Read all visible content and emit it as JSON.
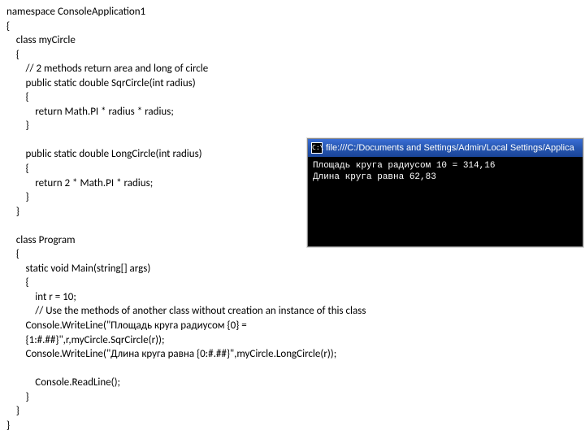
{
  "code": "namespace ConsoleApplication1\n{\n    class myCircle\n    {\n        // 2 methods return area and long of circle\n        public static double SqrCircle(int radius)\n        {\n            return Math.PI * radius * radius;\n        }\n\n        public static double LongCircle(int radius)\n        {\n            return 2 * Math.PI * radius;\n        }\n    }\n\n    class Program\n    {\n        static void Main(string[] args)\n        {\n            int r = 10;\n            // Use the methods of another class without creation an instance of this class\n        Console.WriteLine(\"Площадь круга радиусом {0} =\n        {1:#.##}\",r,myCircle.SqrCircle(r));\n        Console.WriteLine(\"Длина круга равна {0:#.##}\",myCircle.LongCircle(r));\n\n            Console.ReadLine();\n        }\n    }\n}",
  "console": {
    "icon_text": "C:\\",
    "title": "file:///C:/Documents and Settings/Admin/Local Settings/Applica",
    "output": "Площадь круга радиусом 10 = 314,16\nДлина круга равна 62,83"
  }
}
